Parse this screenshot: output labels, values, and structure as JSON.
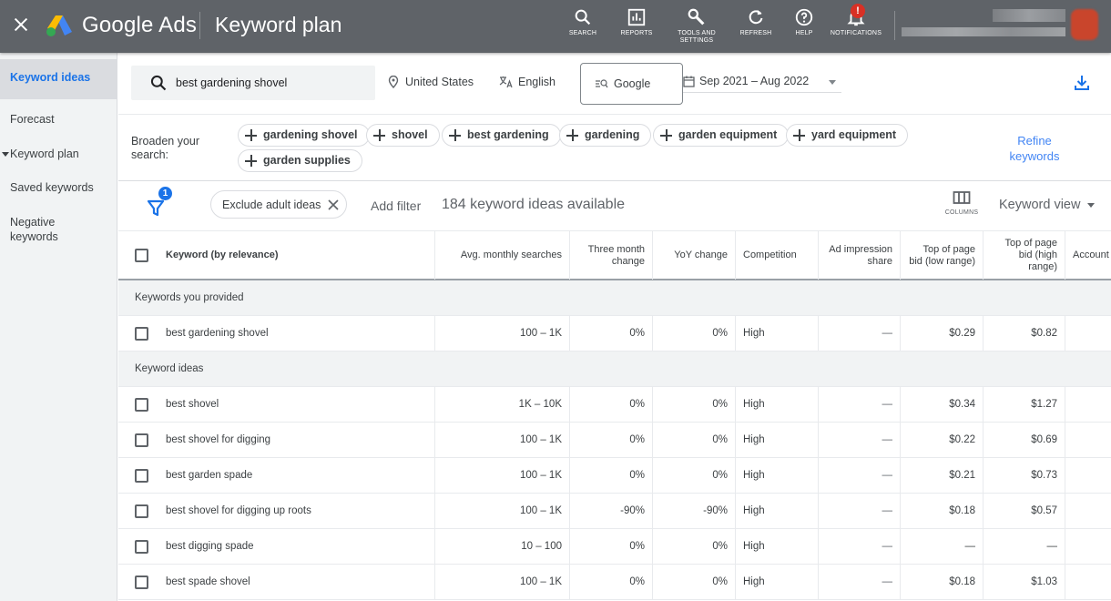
{
  "topbar": {
    "brand": "Google Ads",
    "title": "Keyword plan",
    "tools": [
      {
        "icon": "search-icon",
        "label": "SEARCH"
      },
      {
        "icon": "reports-icon",
        "label": "REPORTS"
      },
      {
        "icon": "wrench-icon",
        "label": "TOOLS AND SETTINGS"
      },
      {
        "icon": "refresh-icon",
        "label": "REFRESH"
      },
      {
        "icon": "help-icon",
        "label": "HELP"
      },
      {
        "icon": "bell-icon",
        "label": "NOTIFICATIONS",
        "badge": "!"
      }
    ],
    "colors": {
      "bar": "#5f6368",
      "badge": "#d93025"
    }
  },
  "sidebar": {
    "items": [
      {
        "label": "Keyword ideas",
        "active": true
      },
      {
        "label": "Forecast"
      },
      {
        "label": "Keyword plan",
        "expandable": true
      },
      {
        "label": "Saved keywords"
      },
      {
        "label": "Negative keywords"
      }
    ]
  },
  "search": {
    "query": "best gardening shovel",
    "location": "United States",
    "language": "English",
    "network": "Google",
    "date_range": "Sep 2021 – Aug 2022"
  },
  "broaden": {
    "label": "Broaden your search:",
    "chips": [
      "gardening shovel",
      "shovel",
      "best gardening",
      "gardening",
      "garden equipment",
      "yard equipment",
      "garden supplies"
    ],
    "refine_label": "Refine keywords"
  },
  "filters": {
    "badge_count": "1",
    "active_filter": "Exclude adult ideas",
    "add_filter": "Add filter",
    "ideas_count": "184 keyword ideas available",
    "columns_label": "COLUMNS",
    "view": "Keyword view"
  },
  "table": {
    "columns": [
      "Keyword (by relevance)",
      "Avg. monthly searches",
      "Three month change",
      "YoY change",
      "Competition",
      "Ad impression share",
      "Top of page bid (low range)",
      "Top of page bid (high range)",
      "Account"
    ],
    "groups": [
      {
        "label": "Keywords you provided",
        "rows": [
          {
            "keyword": "best gardening shovel",
            "searches": "100 – 1K",
            "three_month": "0%",
            "yoy": "0%",
            "competition": "High",
            "impression_share": "—",
            "bid_low": "$0.29",
            "bid_high": "$0.82",
            "account": ""
          }
        ]
      },
      {
        "label": "Keyword ideas",
        "rows": [
          {
            "keyword": "best shovel",
            "searches": "1K – 10K",
            "three_month": "0%",
            "yoy": "0%",
            "competition": "High",
            "impression_share": "—",
            "bid_low": "$0.34",
            "bid_high": "$1.27",
            "account": ""
          },
          {
            "keyword": "best shovel for digging",
            "searches": "100 – 1K",
            "three_month": "0%",
            "yoy": "0%",
            "competition": "High",
            "impression_share": "—",
            "bid_low": "$0.22",
            "bid_high": "$0.69",
            "account": ""
          },
          {
            "keyword": "best garden spade",
            "searches": "100 – 1K",
            "three_month": "0%",
            "yoy": "0%",
            "competition": "High",
            "impression_share": "—",
            "bid_low": "$0.21",
            "bid_high": "$0.73",
            "account": ""
          },
          {
            "keyword": "best shovel for digging up roots",
            "searches": "100 – 1K",
            "three_month": "-90%",
            "yoy": "-90%",
            "competition": "High",
            "impression_share": "—",
            "bid_low": "$0.18",
            "bid_high": "$0.57",
            "account": ""
          },
          {
            "keyword": "best digging spade",
            "searches": "10 – 100",
            "three_month": "0%",
            "yoy": "0%",
            "competition": "High",
            "impression_share": "—",
            "bid_low": "—",
            "bid_high": "—",
            "account": ""
          },
          {
            "keyword": "best spade shovel",
            "searches": "100 – 1K",
            "three_month": "0%",
            "yoy": "0%",
            "competition": "High",
            "impression_share": "—",
            "bid_low": "$0.18",
            "bid_high": "$1.03",
            "account": ""
          }
        ]
      }
    ]
  },
  "colors": {
    "accent": "#1a73e8",
    "link": "#4285f4",
    "sidebar_bg": "#f1f3f4"
  }
}
